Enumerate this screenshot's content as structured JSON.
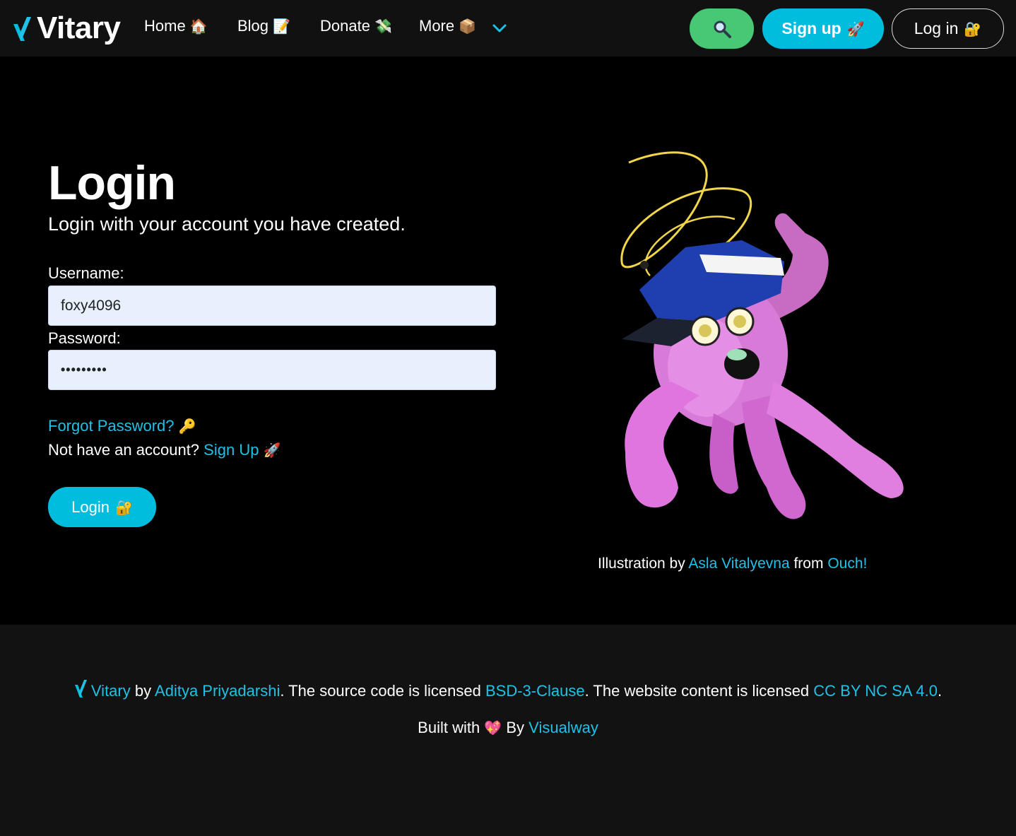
{
  "nav": {
    "brand": "Vitary",
    "home": "Home",
    "home_emoji": "🏠",
    "blog": "Blog",
    "blog_emoji": "📝",
    "donate": "Donate",
    "donate_emoji": "💸",
    "more": "More",
    "more_emoji": "📦",
    "signup": "Sign up",
    "signup_emoji": "🚀",
    "login": "Log in",
    "login_emoji": "🔐"
  },
  "login": {
    "title": "Login",
    "subtitle": "Login with your account you have created.",
    "username_label": "Username:",
    "username_value": "foxy4096",
    "password_label": "Password:",
    "password_value": "•••••••••",
    "forgot": "Forgot Password?",
    "forgot_emoji": "🔑",
    "no_account": "Not have an account?",
    "signup_link": "Sign Up",
    "signup_emoji": "🚀",
    "submit": "Login",
    "submit_emoji": "🔐"
  },
  "illustration": {
    "credit_prefix": "Illustration by",
    "artist": "Asla Vitalyevna",
    "credit_mid": "from",
    "source": "Ouch!"
  },
  "footer": {
    "brand": "Vitary",
    "by": "by",
    "author": "Aditya Priyadarshi",
    "code_text": ". The source code is licensed",
    "code_license": "BSD-3-Clause",
    "content_text": ". The website content is licensed",
    "content_license": "CC BY NC SA 4.0",
    "end": ".",
    "built": "Built with",
    "heart": "💖",
    "built_by": "By",
    "builder": "Visualway"
  },
  "colors": {
    "accent": "#00bcdd",
    "link": "#1fc2e6",
    "search_button": "#48c774",
    "nav_background": "#111111",
    "footer_background": "#121212"
  },
  "icons": {
    "search": "magnifier-icon",
    "dropdown": "chevron-down-icon",
    "logo": "vitary-v-logo-icon"
  }
}
